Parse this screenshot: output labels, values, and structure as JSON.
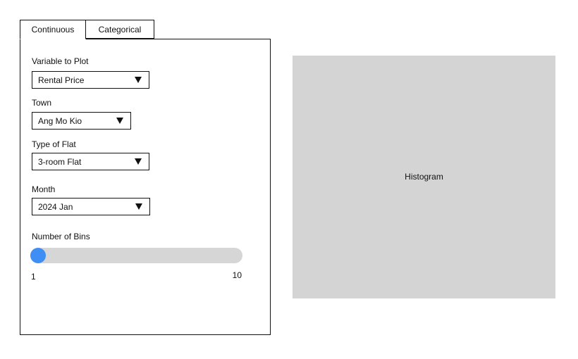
{
  "tabs": [
    {
      "label": "Continuous",
      "active": true
    },
    {
      "label": "Categorical",
      "active": false
    }
  ],
  "fields": {
    "variable": {
      "label": "Variable to Plot",
      "value": "Rental Price"
    },
    "town": {
      "label": "Town",
      "value": "Ang Mo Kio"
    },
    "flat_type": {
      "label": "Type of Flat",
      "value": "3-room Flat"
    },
    "month": {
      "label": "Month",
      "value": "2024 Jan"
    }
  },
  "bins": {
    "label": "Number of Bins",
    "min": "1",
    "max": "10",
    "value": 1
  },
  "histogram": {
    "placeholder": "Histogram"
  },
  "colors": {
    "accent": "#3e8ef5",
    "track": "#d6d6d6",
    "placeholder_bg": "#d4d4d4"
  },
  "icons": {
    "dropdown": "caret-down-icon"
  }
}
